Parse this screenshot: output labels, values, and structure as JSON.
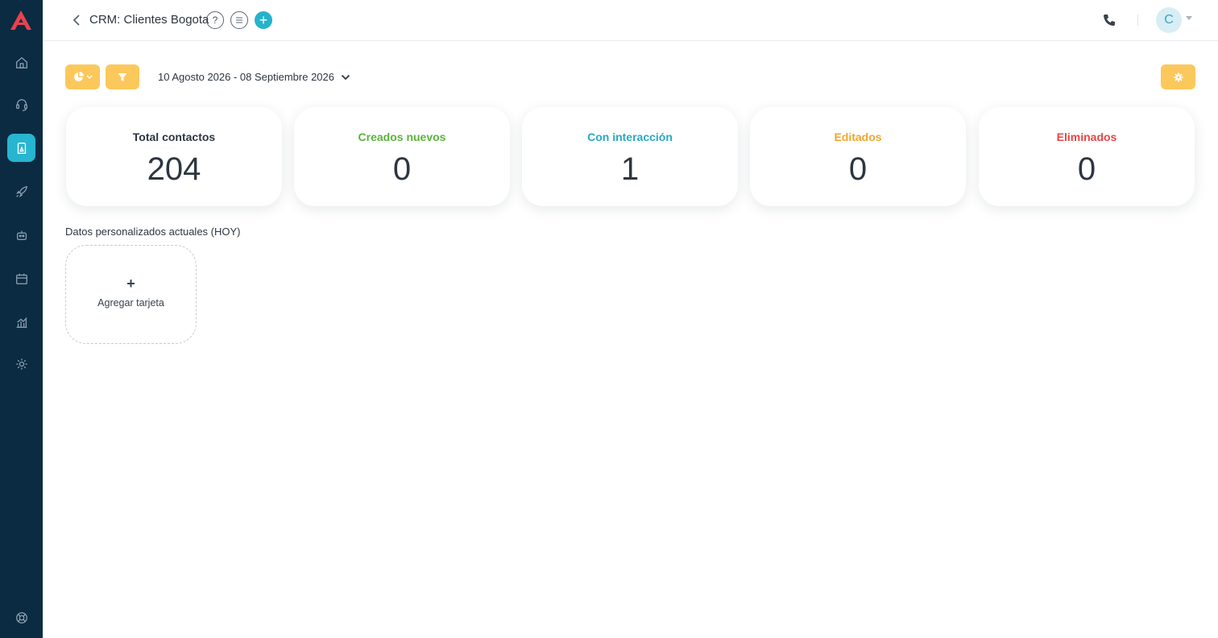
{
  "sidebar": {
    "items": [
      {
        "icon": "home-icon"
      },
      {
        "icon": "headset-icon"
      },
      {
        "icon": "contacts-book-icon",
        "active": true
      },
      {
        "icon": "rocket-icon"
      },
      {
        "icon": "robot-icon"
      },
      {
        "icon": "calendar-icon"
      },
      {
        "icon": "analytics-icon"
      },
      {
        "icon": "gear-icon"
      },
      {
        "icon": "support-icon"
      }
    ]
  },
  "header": {
    "title": "CRM: Clientes Bogota",
    "help_glyph": "?",
    "add_glyph": "+",
    "avatar_initial": "C"
  },
  "toolbar": {
    "date_range": "10 Agosto 2026 - 08 Septiembre 2026"
  },
  "stats": [
    {
      "label": "Total contactos",
      "value": "204",
      "color": "#2d3640"
    },
    {
      "label": "Creados nuevos",
      "value": "0",
      "color": "#5bb33c"
    },
    {
      "label": "Con interacción",
      "value": "1",
      "color": "#27a9c4"
    },
    {
      "label": "Editados",
      "value": "0",
      "color": "#f2a62a"
    },
    {
      "label": "Eliminados",
      "value": "0",
      "color": "#e84545"
    }
  ],
  "custom_section": {
    "title": "Datos personalizados actuales (HOY)",
    "add_card_plus": "+",
    "add_card_label": "Agregar tarjeta"
  },
  "colors": {
    "sidebar_bg": "#0b2b43",
    "accent": "#27b5cf",
    "toolbar_button": "#fcc85c",
    "logo": "#e8424f"
  }
}
